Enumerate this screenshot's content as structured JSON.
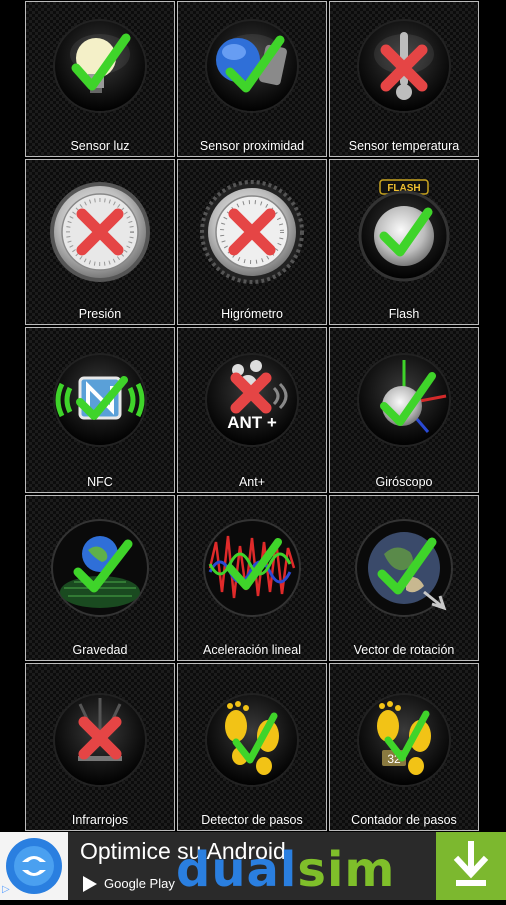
{
  "sensors": [
    {
      "label": "Sensor luz",
      "icon": "light-bulb-icon",
      "status": "check"
    },
    {
      "label": "Sensor proximidad",
      "icon": "proximity-icon",
      "status": "check"
    },
    {
      "label": "Sensor temperatura",
      "icon": "thermometer-icon",
      "status": "cross"
    },
    {
      "label": "Presión",
      "icon": "barometer-icon",
      "status": "cross"
    },
    {
      "label": "Higrómetro",
      "icon": "hygrometer-icon",
      "status": "cross"
    },
    {
      "label": "Flash",
      "icon": "flash-icon",
      "status": "check",
      "icon_text": "FLASH"
    },
    {
      "label": "NFC",
      "icon": "nfc-icon",
      "status": "check"
    },
    {
      "label": "Ant+",
      "icon": "ant-plus-icon",
      "status": "cross",
      "icon_text": "ANT +"
    },
    {
      "label": "Giróscopo",
      "icon": "gyroscope-icon",
      "status": "check"
    },
    {
      "label": "Gravedad",
      "icon": "gravity-globe-icon",
      "status": "check"
    },
    {
      "label": "Aceleración lineal",
      "icon": "waveform-icon",
      "status": "check"
    },
    {
      "label": "Vector de rotación",
      "icon": "rotation-globe-icon",
      "status": "check"
    },
    {
      "label": "Infrarrojos",
      "icon": "infrared-icon",
      "status": "cross"
    },
    {
      "label": "Detector de pasos",
      "icon": "footsteps-icon",
      "status": "check"
    },
    {
      "label": "Contador de pasos",
      "icon": "footsteps-counter-icon",
      "status": "check",
      "icon_text": "32"
    }
  ],
  "ad": {
    "title": "Optimice su Android",
    "store": "Google Play",
    "brand_part1": "dual",
    "brand_part2": "sim",
    "info": "▷"
  },
  "colors": {
    "check": "#3fd42a",
    "cross": "#e54545",
    "ad_download": "#7cb82f"
  }
}
